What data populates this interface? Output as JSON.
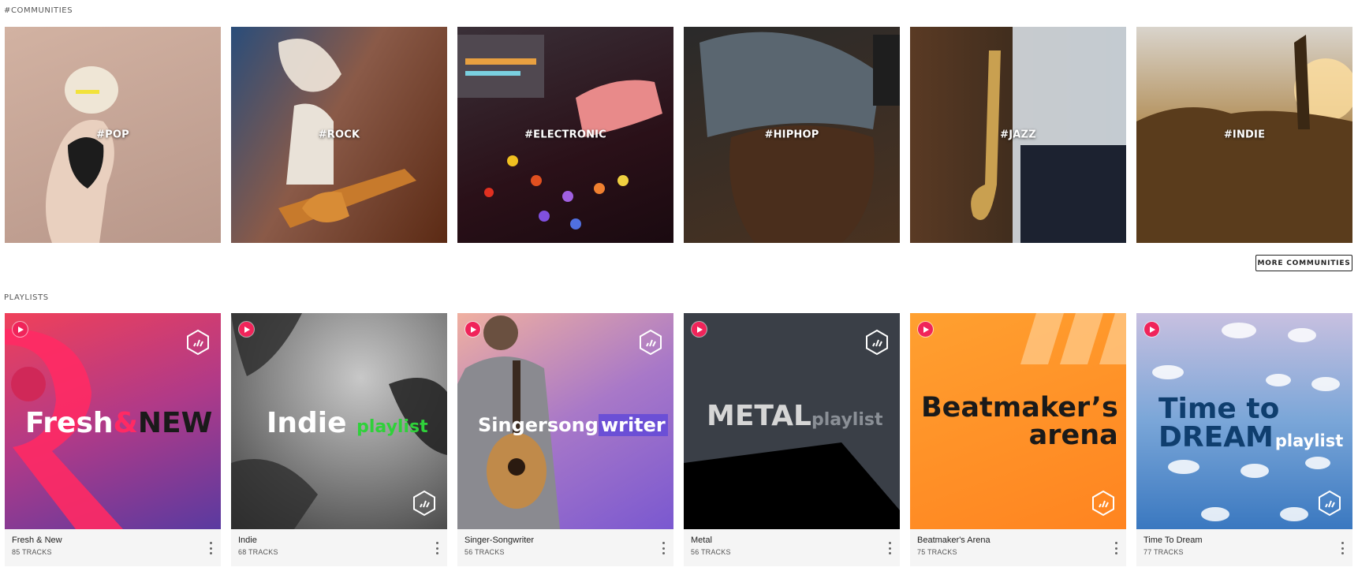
{
  "communities": {
    "section_label": "#COMMUNITIES",
    "tiles": [
      {
        "tag": "#POP",
        "bg": "#c6a493"
      },
      {
        "tag": "#ROCK",
        "bg": "#7a4a2e"
      },
      {
        "tag": "#ELECTRONIC",
        "bg": "#3b1820"
      },
      {
        "tag": "#HIPHOP",
        "bg": "#3a2b1e"
      },
      {
        "tag": "#JAZZ",
        "bg": "#3c2b1c"
      },
      {
        "tag": "#INDIE",
        "bg": "#8b6a3c"
      }
    ],
    "more_button": "MORE COMMUNITIES"
  },
  "playlists": {
    "section_label": "PLAYLISTS",
    "items": [
      {
        "name": "Fresh & New",
        "tracks": "85 TRACKS",
        "title_a": "Fresh",
        "title_amp": "&",
        "title_b": "NEW"
      },
      {
        "name": "Indie",
        "tracks": "68 TRACKS",
        "title_a": "Indie",
        "title_b": "playlist"
      },
      {
        "name": "Singer-Songwriter",
        "tracks": "56 TRACKS",
        "title_a": "Singersong",
        "title_b": "writer"
      },
      {
        "name": "Metal",
        "tracks": "56 TRACKS",
        "title_a": "METAL",
        "title_b": "playlist"
      },
      {
        "name": "Beatmaker's Arena",
        "tracks": "75 TRACKS",
        "title_a": "Beatmaker’s",
        "title_b": "arena"
      },
      {
        "name": "Time To Dream",
        "tracks": "77 TRACKS",
        "title_a": "Time to",
        "title_b": "DREAM",
        "title_c": "playlist"
      }
    ]
  },
  "colors": {
    "accent": "#f0245a",
    "indie_green": "#2fd13a",
    "writer_purple": "#6b4fd6"
  }
}
